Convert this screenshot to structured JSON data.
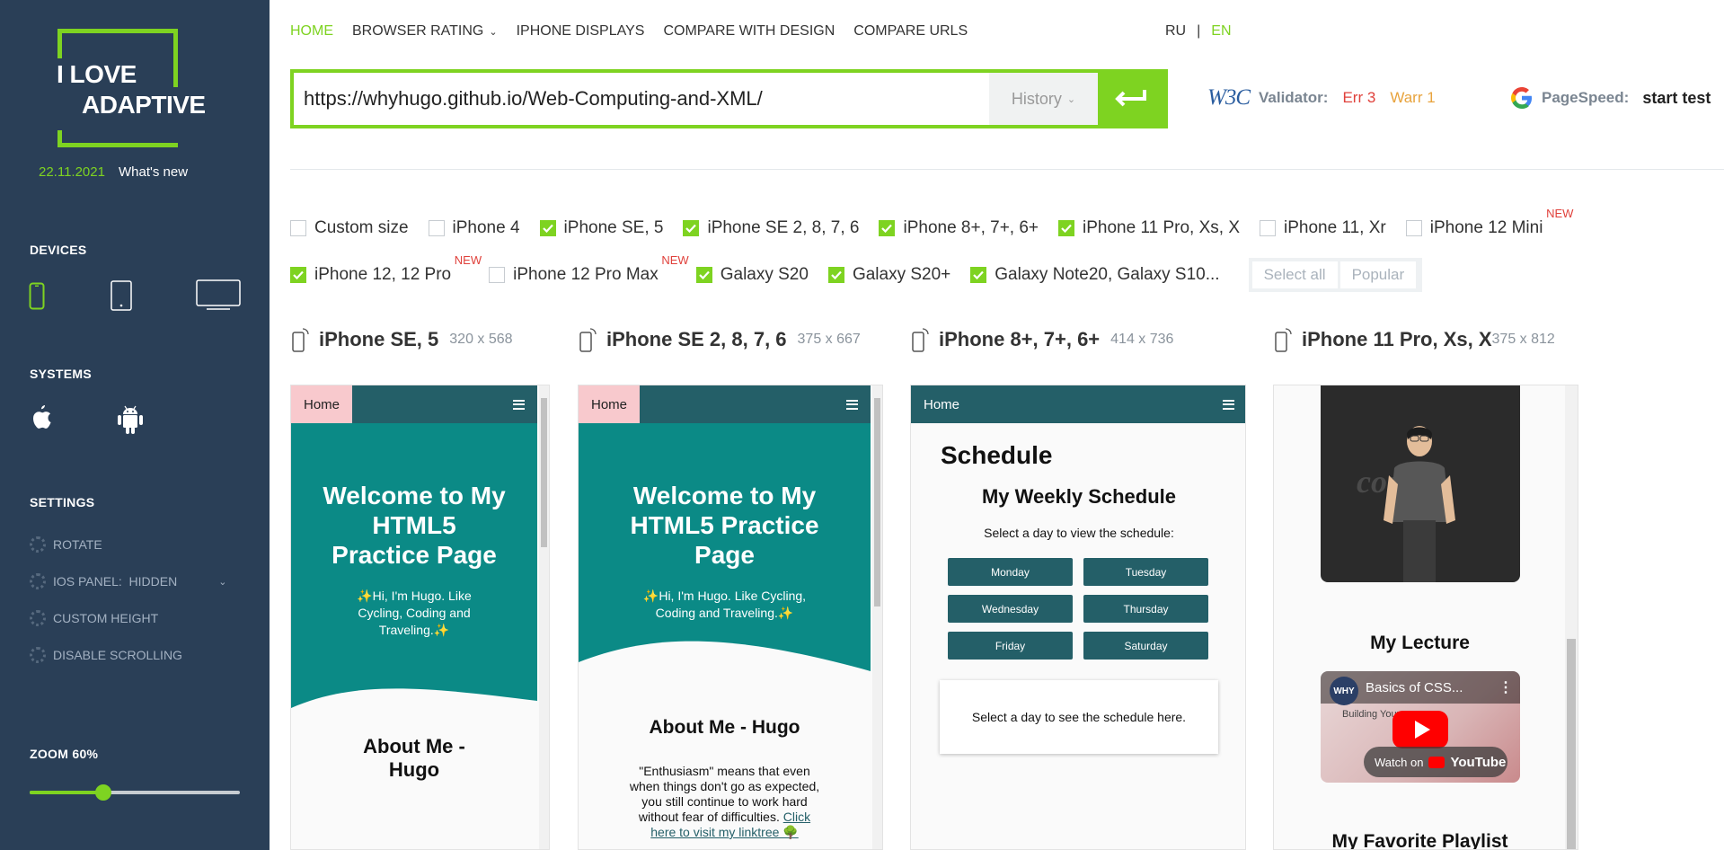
{
  "logo": {
    "line1": "I LOVE",
    "line2": "ADAPTIVE",
    "date": "22.11.2021",
    "whats_new": "What's new"
  },
  "sidebar": {
    "devices_title": "DEVICES",
    "systems_title": "SYSTEMS",
    "settings_title": "SETTINGS",
    "settings": [
      "ROTATE",
      "IOS PANEL:  HIDDEN",
      "CUSTOM HEIGHT",
      "DISABLE SCROLLING"
    ],
    "zoom_label": "ZOOM 60%",
    "zoom_value": 0.35
  },
  "nav": {
    "items": [
      "HOME",
      "BROWSER RATING",
      "IPHONE DISPLAYS",
      "COMPARE WITH DESIGN",
      "COMPARE URLS"
    ],
    "active": "HOME"
  },
  "lang": {
    "ru": "RU",
    "sep": "|",
    "en": "EN"
  },
  "urlbar": {
    "value": "https://whyhugo.github.io/Web-Computing-and-XML/",
    "history": "History"
  },
  "validator": {
    "label": "Validator:",
    "err": "Err 3",
    "warr": "Warr 1"
  },
  "pagespeed": {
    "label": "PageSpeed:",
    "start": "start test"
  },
  "checkboxes_row1": [
    {
      "label": "Custom size",
      "checked": false,
      "new": false
    },
    {
      "label": "iPhone 4",
      "checked": false,
      "new": false
    },
    {
      "label": "iPhone SE, 5",
      "checked": true,
      "new": false
    },
    {
      "label": "iPhone SE 2, 8, 7, 6",
      "checked": true,
      "new": false
    },
    {
      "label": "iPhone 8+, 7+, 6+",
      "checked": true,
      "new": false
    },
    {
      "label": "iPhone 11 Pro, Xs, X",
      "checked": true,
      "new": false
    },
    {
      "label": "iPhone 11, Xr",
      "checked": false,
      "new": false
    },
    {
      "label": "iPhone 12 Mini",
      "checked": false,
      "new": true
    }
  ],
  "checkboxes_row2": [
    {
      "label": "iPhone 12, 12 Pro",
      "checked": true,
      "new": true
    },
    {
      "label": "iPhone 12 Pro Max",
      "checked": false,
      "new": true
    },
    {
      "label": "Galaxy S20",
      "checked": true,
      "new": false
    },
    {
      "label": "Galaxy S20+",
      "checked": true,
      "new": false
    },
    {
      "label": "Galaxy Note20, Galaxy S10...",
      "checked": true,
      "new": false
    }
  ],
  "new_tag": "NEW",
  "select_all": "Select all",
  "popular": "Popular",
  "devices": [
    {
      "name": "iPhone SE, 5",
      "size": "320 x 568"
    },
    {
      "name": "iPhone SE 2, 8, 7, 6",
      "size": "375 x 667"
    },
    {
      "name": "iPhone 8+, 7+, 6+",
      "size": "414 x 736"
    },
    {
      "name": "iPhone 11 Pro, Xs, X",
      "size": "375 x 812"
    }
  ],
  "site": {
    "home": "Home",
    "hero_title_a": "Welcome to My HTML5 Practice Page",
    "hero_text": "✨Hi, I'm Hugo. Like Cycling, Coding and Traveling.✨",
    "about": "About Me - Hugo",
    "about_text": "\"Enthusiasm\" means that even when things don't go as expected, you still continue to work hard without fear of difficulties.",
    "linktree": "Click here to visit my linktree 🌳",
    "schedule": "Schedule",
    "weekly": "My Weekly Schedule",
    "select_day": "Select a day to view the schedule:",
    "days": [
      "Monday",
      "Tuesday",
      "Wednesday",
      "Thursday",
      "Friday",
      "Saturday"
    ],
    "schedule_here": "Select a day to see the schedule here.",
    "lecture": "My Lecture",
    "playlist": "My Favorite Playlist",
    "video_title": "Basics of CSS...",
    "video_sub": "Building Your",
    "watch_on": "Watch on",
    "youtube": "YouTube",
    "why": "WHY"
  },
  "colors": {
    "sidebar": "#2a3f57",
    "accent": "#7ed321",
    "teal": "#0b8a86",
    "topbar": "#245f68"
  }
}
